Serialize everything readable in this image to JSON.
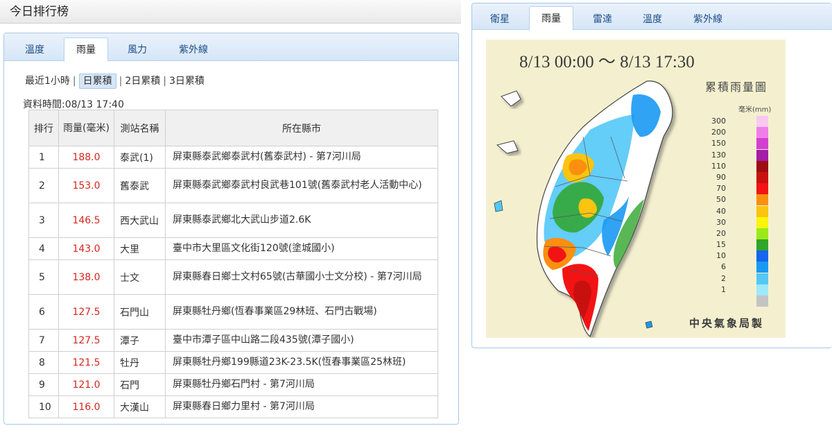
{
  "left": {
    "title": "今日排行榜",
    "tabs": [
      "溫度",
      "雨量",
      "風力",
      "紫外線"
    ],
    "active_tab": "雨量",
    "subnav": [
      "最近1小時",
      "日累積",
      "2日累積",
      "3日累積"
    ],
    "subnav_selected": "日累積",
    "data_time": "資料時間:08/13 17:40",
    "table": {
      "headers": [
        "排行",
        "雨量(毫米)",
        "測站名稱",
        "所在縣市"
      ],
      "rows": [
        {
          "rank": "1",
          "rain": "188.0",
          "station": "泰武(1)",
          "location": "屏東縣泰武鄉泰武村(舊泰武村) - 第7河川局"
        },
        {
          "rank": "2",
          "rain": "153.0",
          "station": "舊泰武",
          "location": "屏東縣泰武鄉泰武村良武巷101號(舊泰武村老人活動中心)"
        },
        {
          "rank": "3",
          "rain": "146.5",
          "station": "西大武山",
          "location": "屏東縣泰武鄉北大武山步道2.6K"
        },
        {
          "rank": "4",
          "rain": "143.0",
          "station": "大里",
          "location": "臺中市大里區文化街120號(塗城國小)"
        },
        {
          "rank": "5",
          "rain": "138.0",
          "station": "士文",
          "location": "屏東縣春日鄉士文村65號(古華國小士文分校) - 第7河川局"
        },
        {
          "rank": "6",
          "rain": "127.5",
          "station": "石門山",
          "location": "屏東縣牡丹鄉(恆春事業區29林班、石門古戰場)"
        },
        {
          "rank": "7",
          "rain": "127.5",
          "station": "潭子",
          "location": "臺中市潭子區中山路二段435號(潭子國小)"
        },
        {
          "rank": "8",
          "rain": "121.5",
          "station": "牡丹",
          "location": "屏東縣牡丹鄉199縣道23K-23.5K(恆春事業區25林班)"
        },
        {
          "rank": "9",
          "rain": "121.0",
          "station": "石門",
          "location": "屏東縣牡丹鄉石門村 - 第7河川局"
        },
        {
          "rank": "10",
          "rain": "116.0",
          "station": "大漢山",
          "location": "屏東縣春日鄉力里村 - 第7河川局"
        }
      ]
    }
  },
  "right": {
    "tabs": [
      "衛星",
      "雨量",
      "雷達",
      "溫度",
      "紫外線"
    ],
    "active_tab": "雨量",
    "map": {
      "title": "8/13 00:00 ～ 8/13 17:30",
      "legend_title": "累積雨量圖",
      "unit": "毫米(mm)",
      "credit": "中央氣象局製",
      "legend": [
        {
          "label": "300",
          "color": "#f9c8f0"
        },
        {
          "label": "200",
          "color": "#f07ee8"
        },
        {
          "label": "150",
          "color": "#d43fd2"
        },
        {
          "label": "130",
          "color": "#a41ca8"
        },
        {
          "label": "110",
          "color": "#9c0d14"
        },
        {
          "label": "90",
          "color": "#c8110f"
        },
        {
          "label": "70",
          "color": "#f21414"
        },
        {
          "label": "50",
          "color": "#fb8f0f"
        },
        {
          "label": "40",
          "color": "#fbc410"
        },
        {
          "label": "30",
          "color": "#f9f50d"
        },
        {
          "label": "20",
          "color": "#9bea18"
        },
        {
          "label": "15",
          "color": "#2fa52b"
        },
        {
          "label": "10",
          "color": "#1465f0"
        },
        {
          "label": "6",
          "color": "#1a99f4"
        },
        {
          "label": "2",
          "color": "#53c8f7"
        },
        {
          "label": "1",
          "color": "#9fe8fb"
        },
        {
          "label": "",
          "color": "#c4c4c4"
        }
      ]
    }
  }
}
